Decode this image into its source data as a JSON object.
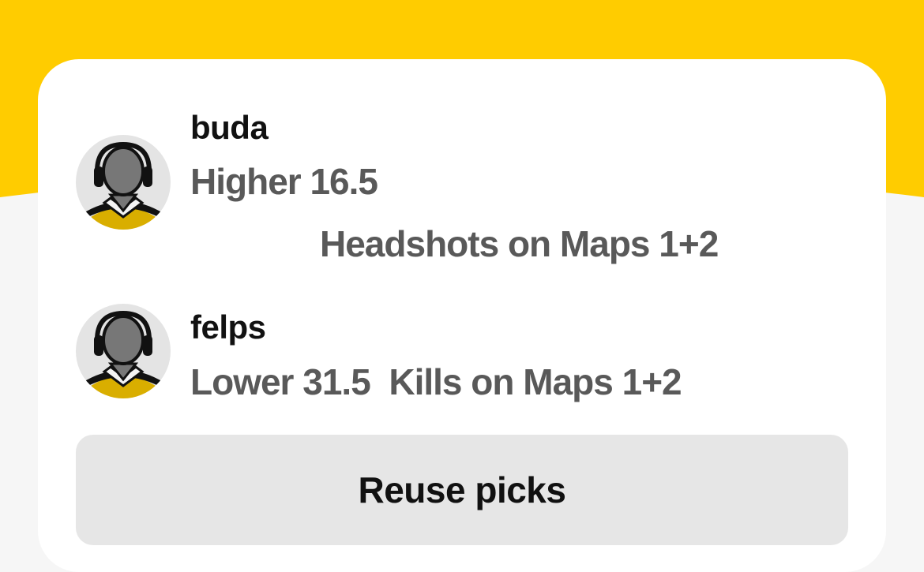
{
  "colors": {
    "accent_yellow": "#FFCC00",
    "page_background": "#F6F6F6",
    "card_background": "#FFFFFF",
    "button_background": "#E6E6E6",
    "name_text": "#111111",
    "pick_text": "#595959"
  },
  "picks": [
    {
      "player": "buda",
      "direction": "Higher",
      "line": "16.5",
      "stat": "Headshots on Maps 1+2",
      "avatar_icon": "player-silhouette-icon"
    },
    {
      "player": "felps",
      "direction": "Lower",
      "line": "31.5",
      "stat": "Kills on Maps 1+2",
      "avatar_icon": "player-silhouette-icon"
    }
  ],
  "actions": {
    "reuse_label": "Reuse picks"
  }
}
